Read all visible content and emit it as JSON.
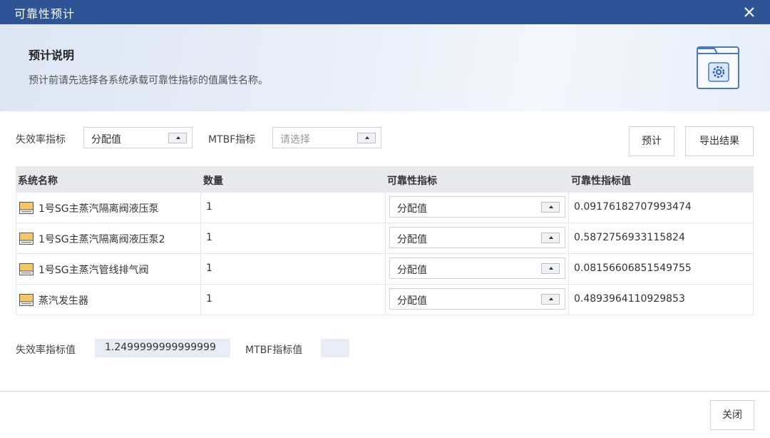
{
  "window": {
    "title": "可靠性预计"
  },
  "banner": {
    "heading": "预计说明",
    "description": "预计前请先选择各系统承载可靠性指标的值属性名称。"
  },
  "filters": {
    "failure_rate_label": "失效率指标",
    "failure_rate_value": "分配值",
    "mtbf_label": "MTBF指标",
    "mtbf_placeholder": "请选择"
  },
  "buttons": {
    "predict": "预计",
    "export": "导出结果",
    "close": "关闭"
  },
  "table": {
    "headers": [
      "系统名称",
      "数量",
      "可靠性指标",
      "可靠性指标值"
    ],
    "rows": [
      {
        "name": "1号SG主蒸汽隔离阀液压泵",
        "qty": "1",
        "indicator": "分配值",
        "value": "0.09176182707993474"
      },
      {
        "name": "1号SG主蒸汽隔离阀液压泵2",
        "qty": "1",
        "indicator": "分配值",
        "value": "0.5872756933115824"
      },
      {
        "name": "1号SG主蒸汽管线排气阀",
        "qty": "1",
        "indicator": "分配值",
        "value": "0.08156606851549755"
      },
      {
        "name": "蒸汽发生器",
        "qty": "1",
        "indicator": "分配值",
        "value": "0.4893964110929853"
      }
    ]
  },
  "summary": {
    "failure_rate_label": "失效率指标值",
    "failure_rate_value": "1.2499999999999999",
    "mtbf_label": "MTBF指标值",
    "mtbf_value": ""
  },
  "icons": {
    "close": "close-icon",
    "window_settings": "window-settings-icon",
    "system": "system-icon"
  },
  "colors": {
    "titlebar": "#2f5496"
  }
}
